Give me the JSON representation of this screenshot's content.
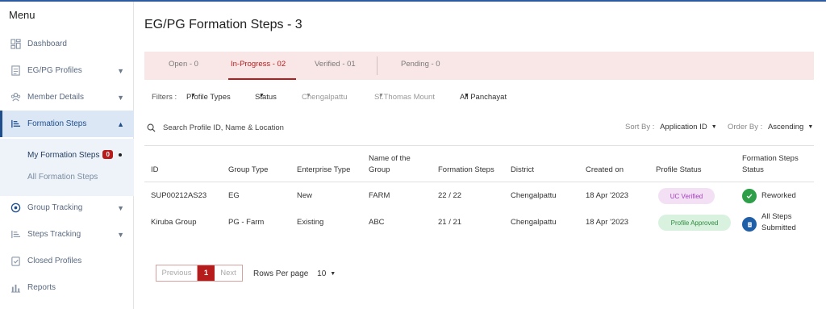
{
  "sidebar": {
    "title": "Menu",
    "items": [
      {
        "label": "Dashboard",
        "icon": "dashboard-icon"
      },
      {
        "label": "EG/PG Profiles",
        "icon": "profiles-icon"
      },
      {
        "label": "Member Details",
        "icon": "members-icon"
      },
      {
        "label": "Formation Steps",
        "icon": "formation-steps-icon"
      },
      {
        "label": "Group Tracking",
        "icon": "tracking-icon"
      },
      {
        "label": "Steps Tracking",
        "icon": "steps-icon"
      },
      {
        "label": "Closed Profiles",
        "icon": "closed-icon"
      },
      {
        "label": "Reports",
        "icon": "reports-icon"
      }
    ],
    "submenu": {
      "current_label": "My Formation Steps",
      "current_badge": "0",
      "other_label": "All Formation Steps"
    }
  },
  "page": {
    "title": "EG/PG Formation Steps -  3"
  },
  "tabs": [
    {
      "label": "Open - 0"
    },
    {
      "label": "In-Progress - 02"
    },
    {
      "label": "Verified - 01"
    },
    {
      "label": "Pending - 0"
    }
  ],
  "filters": {
    "label": "Filters :",
    "profile_types": "Profile Types",
    "status": "Status",
    "district": "Chengalpattu",
    "block": "St.Thomas Mount",
    "panchayat": "All Panchayat"
  },
  "search": {
    "placeholder": "Search Profile ID, Name & Location"
  },
  "sort": {
    "sort_label": "Sort By :",
    "sort_value": "Application ID",
    "order_label": "Order By :",
    "order_value": "Ascending"
  },
  "table": {
    "headers": {
      "id": "ID",
      "group_type": "Group Type",
      "enterprise_type": "Enterprise Type",
      "name_line1": "Name of the",
      "name_line2": "Group",
      "formation_steps": "Formation Steps",
      "district": "District",
      "created_on": "Created on",
      "profile_status": "Profile Status",
      "fs_status_line1": "Formation Steps",
      "fs_status_line2": "Status"
    },
    "rows": [
      {
        "id": "SUP00212AS23",
        "group_type": "EG",
        "enterprise_type": "New",
        "name": "FARM",
        "formation_steps": "22 / 22",
        "district": "Chengalpattu",
        "created_on": "18 Apr '2023",
        "profile_status": "UC Verified",
        "fs_status_line1": "Reworked",
        "fs_status_line2": ""
      },
      {
        "id": "Kiruba Group",
        "group_type": "PG - Farm",
        "enterprise_type": "Existing",
        "name": "ABC",
        "formation_steps": "21 / 21",
        "district": "Chengalpattu",
        "created_on": "18 Apr '2023",
        "profile_status": "Profile Approved",
        "fs_status_line1": "All Steps",
        "fs_status_line2": "Submitted"
      }
    ]
  },
  "pagination": {
    "previous": "Previous",
    "current": "1",
    "next": "Next",
    "rows_label": "Rows Per page",
    "rows_value": "10"
  },
  "colors": {
    "accent": "#b71c1c",
    "nav_active": "#1f4e8c",
    "tab_bg": "#f9e6e6"
  }
}
